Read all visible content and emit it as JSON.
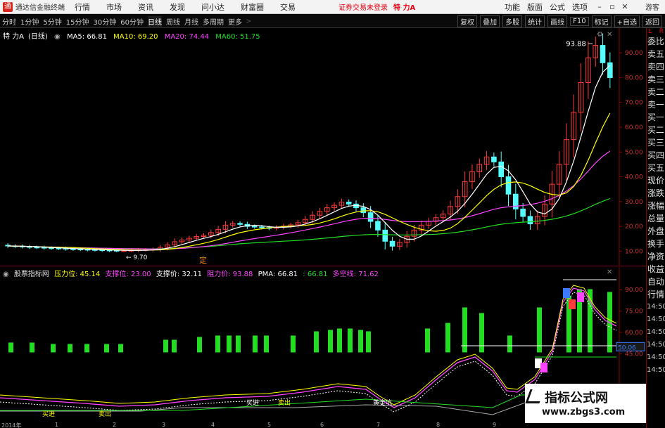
{
  "menubar": {
    "app_title": "通达信金融终端",
    "items": [
      "行情",
      "市场",
      "资讯",
      "发现",
      "问小达",
      "财富圈",
      "交易"
    ],
    "warning": "证券交易未登录",
    "stock_name": "特 力A",
    "right_items": [
      "功能",
      "版面",
      "公式",
      "选项"
    ],
    "guest": "游客"
  },
  "periodbar": {
    "items": [
      "分时",
      "1分钟",
      "5分钟",
      "15分钟",
      "30分钟",
      "60分钟",
      "日线",
      "周线",
      "月线",
      "多周期",
      "更多"
    ],
    "active": "日线",
    "right_tools": [
      "复权",
      "叠加",
      "多股",
      "统计",
      "画线",
      "F10",
      "标记",
      "+自选",
      "返回"
    ]
  },
  "main_info": {
    "title": "特 力A",
    "period": "(日线)",
    "ma": [
      {
        "label": "MA5: 66.81",
        "color": "#ffffff"
      },
      {
        "label": "MA10: 69.20",
        "color": "#ffff00"
      },
      {
        "label": "MA20: 74.44",
        "color": "#ff44ff"
      },
      {
        "label": "MA60: 51.75",
        "color": "#22dd22"
      }
    ],
    "high_label": "93.88",
    "low_label": "9.70",
    "marker": "定",
    "y_ticks": [
      "90.00",
      "80.00",
      "70.00",
      "60.00",
      "50.00",
      "40.00",
      "30.00",
      "20.00",
      "10.00"
    ]
  },
  "ind_info": {
    "name": "股票指标网",
    "fields": [
      {
        "label": "压力位: 45.14",
        "color": "#ffff00"
      },
      {
        "label": "支撑位: 23.00",
        "color": "#ff44ff"
      },
      {
        "label": "支撑价: 32.11",
        "color": "#ffffff"
      },
      {
        "label": "阻力价: 93.88",
        "color": "#ff44ff"
      },
      {
        "label": "PMA: 66.81",
        "color": "#ffffff"
      },
      {
        "label": ": 66.81",
        "color": "#22dd22"
      },
      {
        "label": "多空线: 71.62",
        "color": "#ff44ff"
      }
    ],
    "y_ticks": [
      "90.00",
      "75.00",
      "60.00",
      "45.00"
    ],
    "value_tag": "50.06",
    "chart_texts": [
      "买进",
      "卖出",
      "黄金坑",
      "买进",
      "卖出"
    ]
  },
  "sidebar": {
    "top_l": "L",
    "top_r": "R",
    "items": [
      "委比",
      "卖五",
      "卖四",
      "卖三",
      "卖二",
      "卖一",
      "买一",
      "买二",
      "买三",
      "买四",
      "买五",
      "现价",
      "涨跌",
      "涨幅",
      "总量",
      "外盘",
      "换手",
      "净资",
      "收益",
      "自动",
      "行情",
      "14:50",
      "14:50",
      "14:50",
      "14:50",
      "14:50",
      "14:50"
    ]
  },
  "dates": [
    "2014年",
    "1",
    "2",
    "3",
    "4",
    "5",
    "6",
    "7",
    "8",
    "9"
  ],
  "watermark": {
    "line1": "指标公式网",
    "line2": "www.zbgs3.com"
  },
  "colors": {
    "up": "#ff3b3b",
    "down": "#54ffff",
    "ma5": "#ffffff",
    "ma10": "#ffff00",
    "ma20": "#ff44ff",
    "ma60": "#22dd22",
    "axis_red": "#8b0000"
  },
  "chart_data": {
    "type": "candlestick",
    "ylim": [
      5,
      96
    ],
    "note_points": 84,
    "close": [
      12.1,
      12.0,
      11.8,
      11.6,
      11.5,
      11.3,
      11.2,
      11.1,
      10.9,
      10.8,
      10.7,
      10.6,
      10.5,
      10.4,
      10.3,
      10.2,
      10.2,
      10.3,
      10.5,
      10.6,
      10.8,
      11.5,
      12.5,
      13.8,
      14.5,
      15.2,
      15.9,
      16.4,
      17.5,
      18.8,
      20.5,
      21.2,
      20.8,
      20.0,
      19.8,
      19.5,
      19.2,
      19.6,
      20.1,
      20.6,
      21.5,
      22.8,
      24.5,
      26.0,
      27.5,
      28.5,
      29.8,
      29.0,
      27.5,
      25.5,
      22.0,
      18.5,
      14.0,
      12.0,
      13.5,
      16.0,
      18.5,
      20.5,
      22.0,
      23.5,
      25.0,
      28.0,
      32.0,
      38.0,
      42.0,
      45.0,
      48.0,
      46.0,
      40.0,
      33.0,
      27.0,
      24.0,
      21.0,
      24.0,
      29.0,
      37.0,
      45.0,
      55.0,
      66.0,
      78.0,
      88.0,
      93.0,
      86.0,
      80.0
    ]
  }
}
